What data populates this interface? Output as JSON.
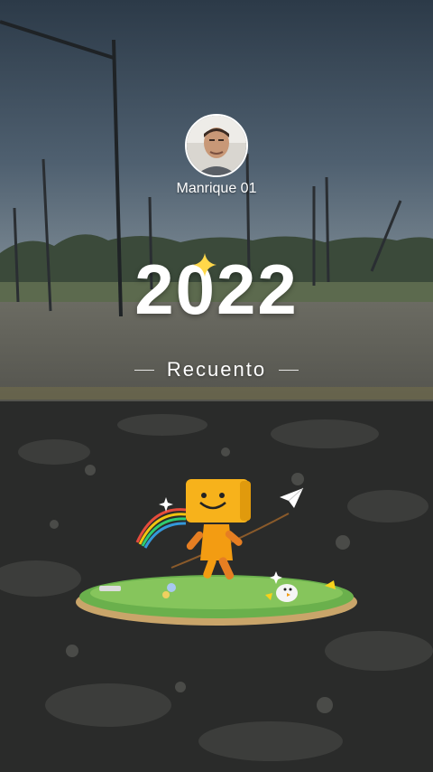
{
  "profile": {
    "username": "Manrique 01"
  },
  "recap": {
    "year": "2022",
    "subtitle": "Recuento"
  },
  "colors": {
    "text": "#ffffff",
    "mascot_yellow": "#f7b21b",
    "grass": "#6ab04c"
  },
  "icons": {
    "sparkle": "sparkle-icon",
    "paper_plane": "paper-plane-icon"
  }
}
